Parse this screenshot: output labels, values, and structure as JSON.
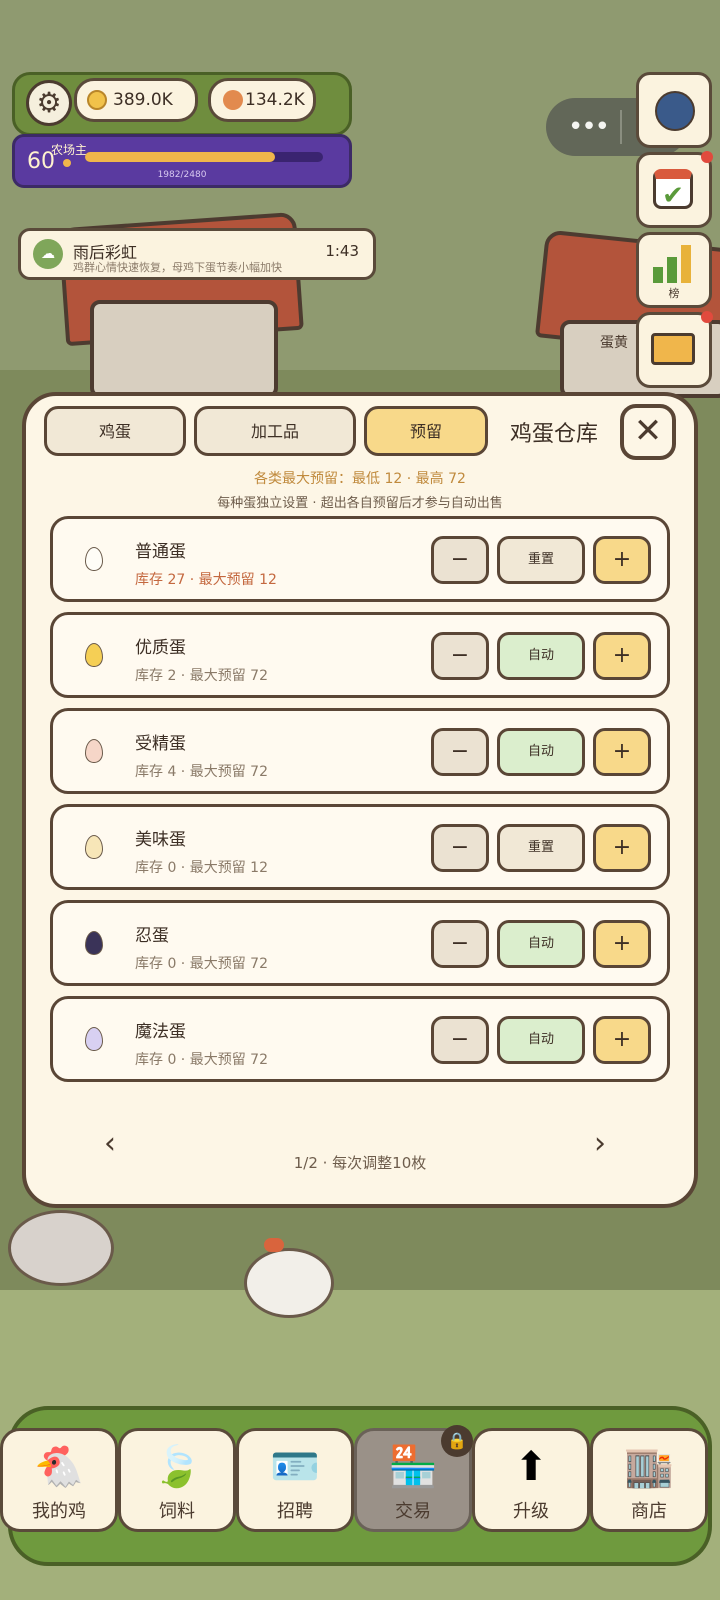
{
  "hud": {
    "coins": "389.0K",
    "seeds": "134.2K",
    "level": "60",
    "level_title": "农场主",
    "xp_text": "1982/2480",
    "xp_progress": 0.8
  },
  "event": {
    "name": "雨后彩虹",
    "desc": "鸡群心情快速恢复，母鸡下蛋节奏小幅加快",
    "time": "1:43"
  },
  "side_buttons": {
    "rank_label": "榜"
  },
  "house_sign": "蛋黄",
  "panel": {
    "tabs": [
      {
        "label": "鸡蛋",
        "active": false
      },
      {
        "label": "加工品",
        "active": false
      },
      {
        "label": "预留",
        "active": true
      }
    ],
    "title": "鸡蛋仓库",
    "info_line1": "各类最大预留：最低 12 · 最高 72",
    "info_line2": "每种蛋独立设置 · 超出各自预留后才参与自动出售",
    "rows": [
      {
        "name": "普通蛋",
        "stock": "库存 27 · 最大预留 12",
        "warn": true,
        "mode": "重置",
        "egg_color": "#fffdf7"
      },
      {
        "name": "优质蛋",
        "stock": "库存 2 · 最大预留 72",
        "warn": false,
        "mode": "自动",
        "egg_color": "#f5cf55"
      },
      {
        "name": "受精蛋",
        "stock": "库存 4 · 最大预留 72",
        "warn": false,
        "mode": "自动",
        "egg_color": "#f6d6c8"
      },
      {
        "name": "美味蛋",
        "stock": "库存 0 · 最大预留 12",
        "warn": false,
        "mode": "重置",
        "egg_color": "#f7e6b8"
      },
      {
        "name": "忍蛋",
        "stock": "库存 0 · 最大预留 72",
        "warn": false,
        "mode": "自动",
        "egg_color": "#3a3358"
      },
      {
        "name": "魔法蛋",
        "stock": "库存 0 · 最大预留 72",
        "warn": false,
        "mode": "自动",
        "egg_color": "#d8d0f2"
      }
    ],
    "minus_label": "−",
    "plus_label": "+",
    "pager_prev": "‹",
    "pager_next": "›",
    "pager_text": "1/2 · 每次调整10枚"
  },
  "nav": [
    {
      "label": "我的鸡",
      "icon": "🐔"
    },
    {
      "label": "饲料",
      "icon": "🍃"
    },
    {
      "label": "招聘",
      "icon": "🪪"
    },
    {
      "label": "交易",
      "icon": "🏪"
    },
    {
      "label": "升级",
      "icon": "⬆"
    },
    {
      "label": "商店",
      "icon": "🏬"
    }
  ]
}
